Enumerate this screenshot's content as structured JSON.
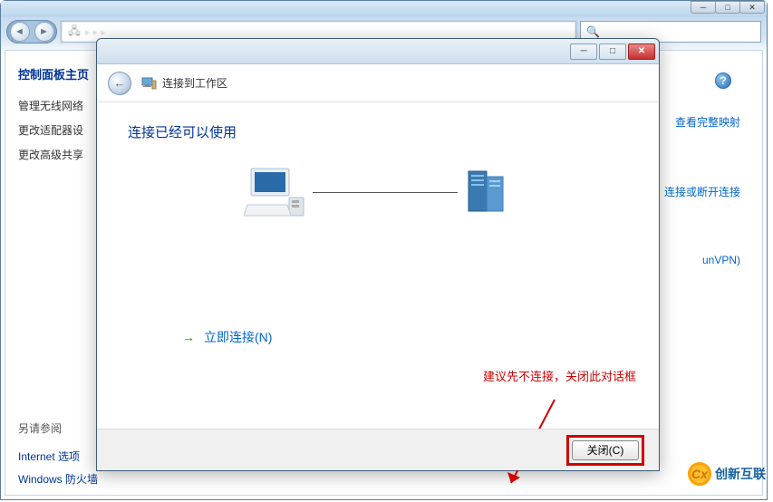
{
  "explorer": {
    "panel_heading": "控制面板主页",
    "tasks": [
      "管理无线网络",
      "更改适配器设",
      "更改高级共享"
    ],
    "also_see": "另请参阅",
    "links": [
      "Internet 选项",
      "Windows 防火墙"
    ],
    "right_links": [
      "查看完整映射",
      "连接或断开连接",
      "unVPN)"
    ]
  },
  "wizard": {
    "title": "连接到工作区",
    "heading": "连接已经可以使用",
    "connect_now": "立即连接(N)",
    "close_btn": "关闭(C)"
  },
  "annotation": "建议先不连接，关闭此对话框",
  "watermark": "创新互联"
}
